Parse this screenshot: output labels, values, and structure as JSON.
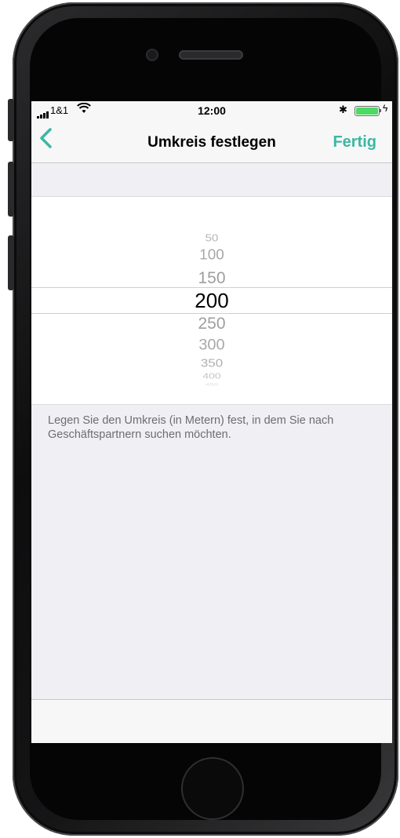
{
  "status_bar": {
    "carrier": "1&1",
    "time": "12:00",
    "bluetooth_icon": "bluetooth-icon",
    "battery_level": 1.0,
    "battery_color": "#4cd964"
  },
  "nav": {
    "back_icon": "chevron-left-icon",
    "title": "Umkreis festlegen",
    "done_label": "Fertig",
    "accent_color": "#3bb7a4"
  },
  "picker": {
    "selected": "200",
    "items": [
      "50",
      "100",
      "150",
      "200",
      "250",
      "300",
      "350",
      "400",
      "450"
    ]
  },
  "description": "Legen Sie den Umkreis (in Metern) fest, in dem Sie nach Geschäftspartnern suchen möchten."
}
